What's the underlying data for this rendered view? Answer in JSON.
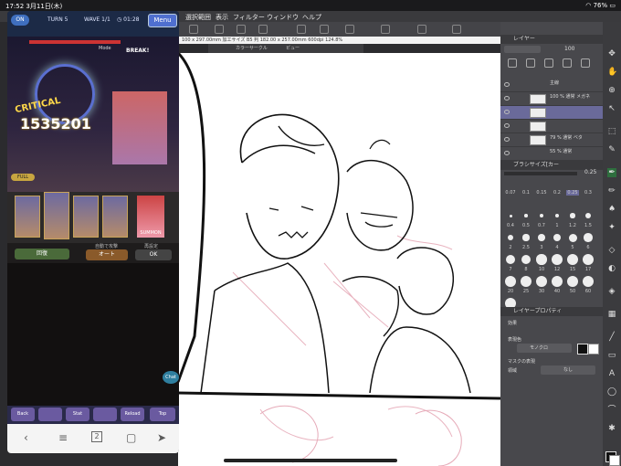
{
  "status": {
    "time": "17:52",
    "date": "3月11日(木)",
    "battery": "76%"
  },
  "menu": [
    "選択範囲",
    "表示",
    "フィルター",
    "ウィンドウ",
    "ヘルプ"
  ],
  "canvas_info": "100 x 297.00mm 加工サイズ B5 判 182.00 x 257.00mm 600dpi 124.8%",
  "subtabs": [
    "カラーサークル",
    "ビュー"
  ],
  "game": {
    "on_label": "ON",
    "turn": "TURN 5",
    "wave": "WAVE 1/1",
    "timer": "01:28",
    "menu_button": "Menu",
    "mode": "Mode",
    "break": "BREAK!",
    "critical_text": "CRITICAL",
    "damage": "1535201",
    "full_label": "FULL",
    "heal_button": "回復",
    "auto_label": "オート",
    "auto_top": "自動で攻撃",
    "summon_label": "SUMMON",
    "ok_label": "OK",
    "ok_top": "再設定",
    "chat_label": "Chat",
    "bottom_icons": [
      "Back",
      "",
      "Stat",
      "",
      "Reload",
      "Top"
    ]
  },
  "right_panel": {
    "layer_title": "レイヤー",
    "opacity": "100",
    "layers": [
      {
        "name": "主線"
      },
      {
        "name": "100 % 通常 メガネ"
      },
      {
        "name": ""
      },
      {
        "name": "79 % 通常 ベタ"
      },
      {
        "name": "55 % 通常"
      }
    ],
    "brush_title": "ブラシサイズ[カー",
    "brush_value": "0.25",
    "brush_sizes": [
      "0.07",
      "0.1",
      "0.15",
      "0.2",
      "0.25",
      "0.3"
    ],
    "brush_sizes2": [
      "0.4",
      "0.5",
      "0.7",
      "1",
      "1.2",
      "1.5",
      "2",
      "2.5",
      "3",
      "4",
      "5",
      "6",
      "7",
      "8",
      "10",
      "12",
      "15",
      "17",
      "20",
      "25",
      "30",
      "40",
      "50",
      "60",
      "70"
    ],
    "prop_title": "レイヤープロパティ",
    "effect_label": "効果",
    "color_label": "表現色",
    "color_value": "モノクロ",
    "mask_label": "マスクの表現",
    "area_label": "領域",
    "area_value": "なし"
  }
}
